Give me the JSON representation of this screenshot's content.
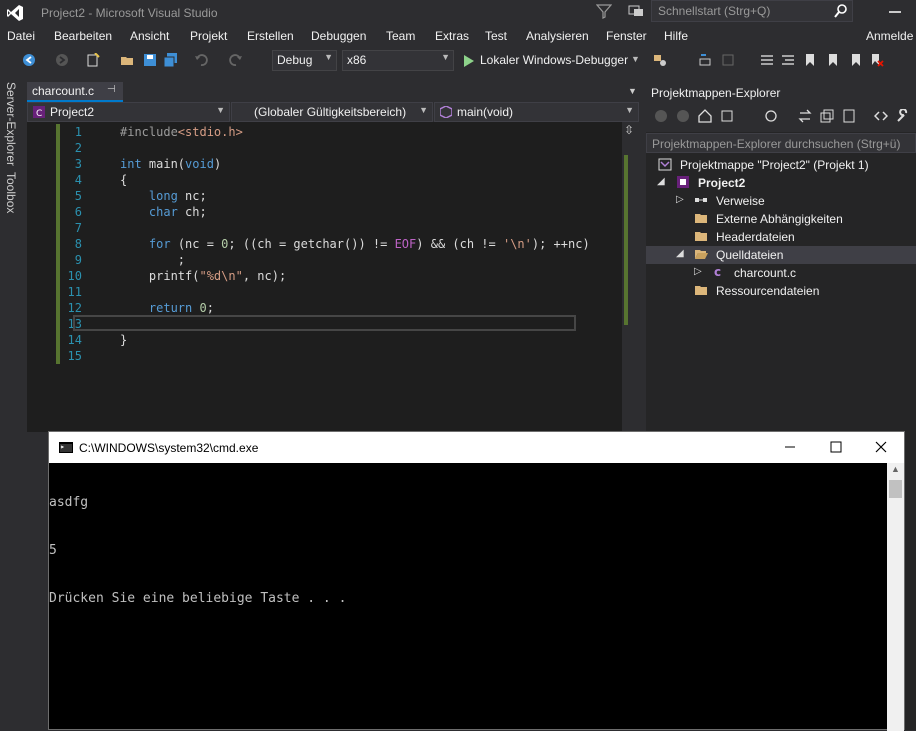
{
  "window": {
    "title": "Project2 - Microsoft Visual Studio",
    "quicklaunch_placeholder": "Schnellstart (Strg+Q)"
  },
  "menu": {
    "items": [
      "Datei",
      "Bearbeiten",
      "Ansicht",
      "Projekt",
      "Erstellen",
      "Debuggen",
      "Team",
      "Extras",
      "Test",
      "Analysieren",
      "Fenster",
      "Hilfe"
    ],
    "signin": "Anmelde"
  },
  "toolbar": {
    "config": "Debug",
    "platform": "x86",
    "run_label": "Lokaler Windows-Debugger"
  },
  "sidebar": {
    "tabs": [
      "Server-Explorer",
      "Toolbox"
    ]
  },
  "editor": {
    "tab_label": "charcount.c",
    "nav_project": "Project2",
    "nav_scope": "(Globaler Gültigkeitsbereich)",
    "nav_member": "main(void)",
    "lines": [
      {
        "n": "1",
        "html": "<span class=\"pp\">#include</span><span class=\"st\">&lt;stdio.h&gt;</span>"
      },
      {
        "n": "2",
        "html": ""
      },
      {
        "n": "3",
        "html": "<span class=\"kw\">int</span> main(<span class=\"kw\">void</span>)"
      },
      {
        "n": "4",
        "html": "{"
      },
      {
        "n": "5",
        "html": "    <span class=\"kw\">long</span> nc;"
      },
      {
        "n": "6",
        "html": "    <span class=\"kw\">char</span> ch;"
      },
      {
        "n": "7",
        "html": ""
      },
      {
        "n": "8",
        "html": "    <span class=\"kw\">for</span> (nc = <span class=\"nm\">0</span>; ((ch = getchar()) != <span class=\"mc\">EOF</span>) &amp;&amp; (ch != <span class=\"st\">'\\n'</span>); ++nc)"
      },
      {
        "n": "9",
        "html": "        ;"
      },
      {
        "n": "10",
        "html": "    printf(<span class=\"st\">\"%d\\n\"</span>, nc);"
      },
      {
        "n": "11",
        "html": ""
      },
      {
        "n": "12",
        "html": "    <span class=\"kw\">return</span> <span class=\"nm\">0</span>;"
      },
      {
        "n": "13",
        "html": ""
      },
      {
        "n": "14",
        "html": "}"
      },
      {
        "n": "15",
        "html": ""
      }
    ]
  },
  "solution_explorer": {
    "title": "Projektmappen-Explorer",
    "search_placeholder": "Projektmappen-Explorer durchsuchen (Strg+ü)",
    "items": [
      {
        "label": "Projektmappe \"Project2\" (Projekt 1)",
        "icon": "solution-icon",
        "bold": false
      },
      {
        "label": "Project2",
        "icon": "project-icon",
        "bold": true
      },
      {
        "label": "Verweise",
        "icon": "references-icon",
        "bold": false
      },
      {
        "label": "Externe Abhängigkeiten",
        "icon": "folder-icon",
        "bold": false
      },
      {
        "label": "Headerdateien",
        "icon": "folder-icon",
        "bold": false
      },
      {
        "label": "Quelldateien",
        "icon": "folder-open-icon",
        "bold": false
      },
      {
        "label": "charcount.c",
        "icon": "c-file-icon",
        "bold": false
      },
      {
        "label": "Ressourcendateien",
        "icon": "folder-icon",
        "bold": false
      }
    ]
  },
  "console": {
    "title": "C:\\WINDOWS\\system32\\cmd.exe",
    "output": [
      "asdfg",
      "5",
      "Drücken Sie eine beliebige Taste . . ."
    ]
  },
  "colors": {
    "accent": "#007acc",
    "background": "#2d2d30",
    "editor": "#1e1e1e",
    "keyword": "#569cd6"
  }
}
